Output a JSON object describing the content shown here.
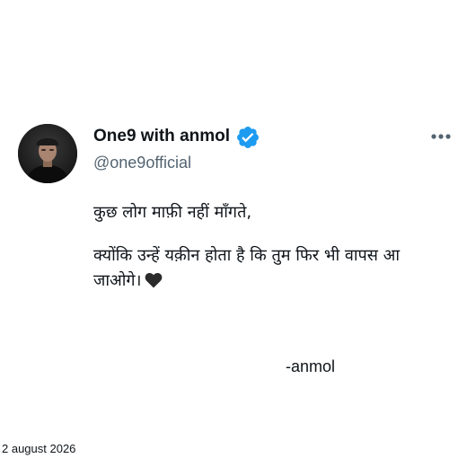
{
  "author": {
    "name": "One9 with anmol",
    "handle": "@one9official",
    "verified": true,
    "verified_color": "#1d9bf0"
  },
  "post": {
    "line1": "कुछ लोग माफ़ी नहीं माँगते,",
    "line2": "क्योंकि उन्हें यक़ीन होता है कि तुम फिर भी वापस आ",
    "line3": "जाओगे।",
    "emoji": "black-heart-icon",
    "signature": "-anmol"
  },
  "footer": {
    "date": "2 august 2026"
  },
  "icons": {
    "more": "more-options-icon",
    "verified": "verified-badge-icon"
  }
}
